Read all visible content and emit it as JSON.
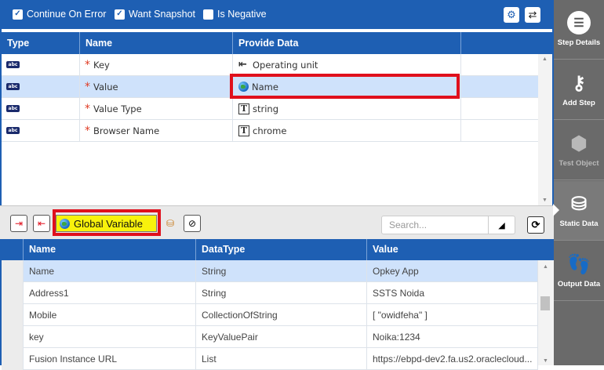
{
  "options": {
    "continue_on_error": {
      "label": "Continue On Error",
      "checked": true
    },
    "want_snapshot": {
      "label": "Want Snapshot",
      "checked": true
    },
    "is_negative": {
      "label": "Is Negative",
      "checked": false
    }
  },
  "top_grid": {
    "headers": [
      "Type",
      "Name",
      "Provide Data"
    ],
    "rows": [
      {
        "type_icon": "abc-icon",
        "required": "*",
        "name": "Key",
        "data_icon": "input-arrow-icon",
        "data": "Operating unit"
      },
      {
        "type_icon": "abc-icon",
        "required": "*",
        "name": "Value",
        "data_icon": "globe-icon",
        "data": "Name",
        "selected": true
      },
      {
        "type_icon": "abc-icon",
        "required": "*",
        "name": "Value Type",
        "data_icon": "text-T-icon",
        "data": "string"
      },
      {
        "type_icon": "abc-icon",
        "required": "*",
        "name": "Browser Name",
        "data_icon": "text-T-icon",
        "data": "chrome"
      }
    ]
  },
  "toolbar": {
    "global_variable_label": "Global Variable",
    "search_placeholder": "Search..."
  },
  "bottom_grid": {
    "headers": [
      "Name",
      "DataType",
      "Value"
    ],
    "rows": [
      {
        "name": "Name",
        "datatype": "String",
        "value": "Opkey App",
        "selected": true
      },
      {
        "name": "Address1",
        "datatype": "String",
        "value": "SSTS Noida"
      },
      {
        "name": "Mobile",
        "datatype": "CollectionOfString",
        "value": "[ \"owidfeha\" ]"
      },
      {
        "name": "key",
        "datatype": "KeyValuePair",
        "value": "Noika:1234"
      },
      {
        "name": "Fusion Instance URL",
        "datatype": "List",
        "value": "https://ebpd-dev2.fa.us2.oraclecloud..."
      }
    ]
  },
  "sidebar": {
    "items": [
      {
        "label": "Step Details",
        "icon": "checklist-icon"
      },
      {
        "label": "Add Step",
        "icon": "key-plus-icon"
      },
      {
        "label": "Test Object",
        "icon": "cube-icon",
        "disabled": true
      },
      {
        "label": "Static Data",
        "icon": "database-icon",
        "active": true
      },
      {
        "label": "Output Data",
        "icon": "footprints-icon"
      }
    ]
  },
  "colors": {
    "header_blue": "#1e5fb3",
    "selected_row": "#cfe2fb",
    "highlight_red": "#e0101c",
    "global_yellow": "#f8f20c",
    "sidebar_gray": "#6a6a6a"
  }
}
